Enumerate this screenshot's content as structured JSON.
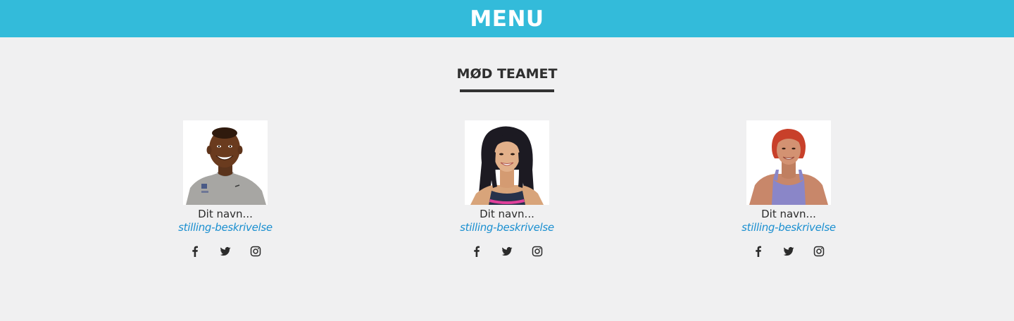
{
  "header": {
    "menu_label": "MENU",
    "background_color": "#33bbda"
  },
  "team_section": {
    "title": "MØD TEAMET",
    "members": [
      {
        "name": "Dit navn...",
        "role": "stilling-beskrivelse",
        "photo": "man-in-grey-tshirt-portrait",
        "socials": [
          "facebook-icon",
          "twitter-icon",
          "instagram-icon"
        ]
      },
      {
        "name": "Dit navn...",
        "role": "stilling-beskrivelse",
        "photo": "woman-with-dark-hair-portrait",
        "socials": [
          "facebook-icon",
          "twitter-icon",
          "instagram-icon"
        ]
      },
      {
        "name": "Dit navn...",
        "role": "stilling-beskrivelse",
        "photo": "woman-with-red-hair-portrait",
        "socials": [
          "facebook-icon",
          "twitter-icon",
          "instagram-icon"
        ]
      }
    ]
  },
  "colors": {
    "page_background": "#f0f0f1",
    "role_text": "#1a8fd0",
    "heading_text": "#2e2e2e"
  }
}
